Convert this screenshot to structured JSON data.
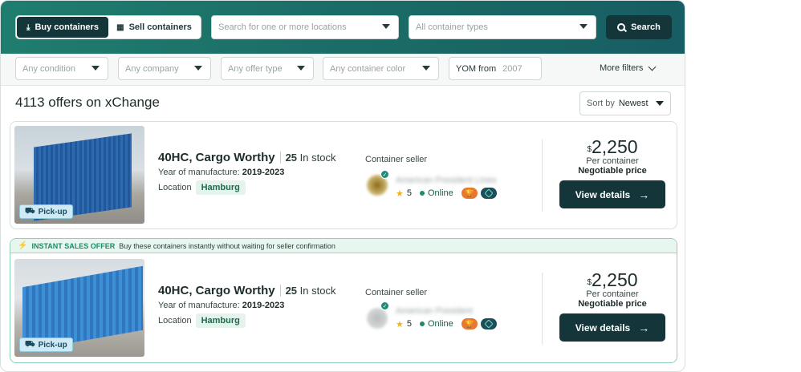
{
  "topbar": {
    "buy_label": "Buy containers",
    "sell_label": "Sell containers",
    "locations_placeholder": "Search for one or more locations",
    "container_types_placeholder": "All container types",
    "search_label": "Search"
  },
  "filters": {
    "condition": "Any condition",
    "company": "Any company",
    "offer_type": "Any offer type",
    "color": "Any container color",
    "yom_label": "YOM from",
    "yom_value": "2007",
    "more_filters": "More filters"
  },
  "results": {
    "count_text": "4113 offers on xChange",
    "sort_label": "Sort by",
    "sort_value": "Newest"
  },
  "offers": [
    {
      "title": "40HC, Cargo Worthy",
      "stock_num": "25",
      "stock_text": "In stock",
      "yom_label": "Year of manufacture:",
      "yom_value": "2019-2023",
      "location_label": "Location",
      "location_value": "Hamburg",
      "pickup": "Pick-up",
      "seller_label": "Container seller",
      "seller_name": "American President Lines",
      "rating": "5",
      "online": "Online",
      "currency": "$",
      "price": "2,250",
      "per": "Per container",
      "negotiable": "Negotiable price",
      "cta": "View details",
      "instant": false
    },
    {
      "title": "40HC, Cargo Worthy",
      "stock_num": "25",
      "stock_text": "In stock",
      "yom_label": "Year of manufacture:",
      "yom_value": "2019-2023",
      "location_label": "Location",
      "location_value": "Hamburg",
      "pickup": "Pick-up",
      "seller_label": "Container seller",
      "seller_name": "American President",
      "rating": "5",
      "online": "Online",
      "currency": "$",
      "price": "2,250",
      "per": "Per container",
      "negotiable": "Negotiable price",
      "cta": "View details",
      "instant": true,
      "instant_tag": "INSTANT SALES OFFER",
      "instant_desc": "Buy these containers instantly without waiting for seller confirmation"
    }
  ],
  "colors": {
    "brand_dark": "#14363a",
    "header_gradient_start": "#1f7d6e",
    "header_gradient_end": "#175d63",
    "accent_green": "#1a8c66"
  }
}
